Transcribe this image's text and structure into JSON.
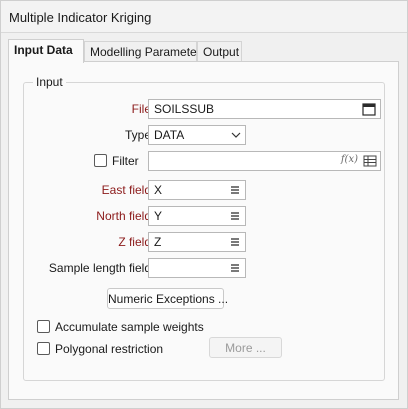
{
  "window": {
    "title": "Multiple Indicator Kriging"
  },
  "tabs": [
    {
      "label": "Input Data",
      "active": true
    },
    {
      "label": "Modelling Parameters",
      "active": false
    },
    {
      "label": "Output",
      "active": false
    }
  ],
  "input_group": {
    "label": "Input",
    "file": {
      "label": "File",
      "value": "SOILSSUB",
      "icon": "calendar-grid-icon"
    },
    "type": {
      "label": "Type",
      "value": "DATA",
      "icon": "chevron-down-icon"
    },
    "filter": {
      "label": "Filter",
      "checked": false,
      "value": "",
      "fx_label": "f(x)",
      "icon": "table-icon"
    },
    "east_field": {
      "label": "East field",
      "value": "X",
      "icon": "list-icon"
    },
    "north_field": {
      "label": "North field",
      "value": "Y",
      "icon": "list-icon"
    },
    "z_field": {
      "label": "Z field",
      "value": "Z",
      "icon": "list-icon"
    },
    "sample_length_field": {
      "label": "Sample length field",
      "value": "",
      "icon": "list-icon"
    },
    "numeric_exceptions_button": "Numeric Exceptions ...",
    "accumulate_sample_weights": {
      "label": "Accumulate sample weights",
      "checked": false
    },
    "polygonal_restriction": {
      "label": "Polygonal restriction",
      "checked": false
    },
    "more_button": "More ..."
  },
  "colors": {
    "required_label": "#8b1a1a",
    "panel_bg": "#fafafa",
    "window_bg": "#f0f0f0"
  }
}
